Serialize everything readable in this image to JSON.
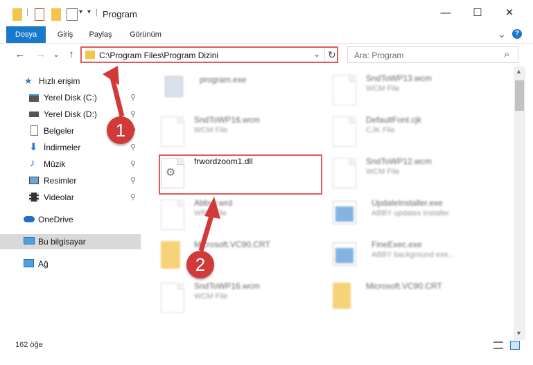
{
  "window": {
    "title": "Program",
    "minimize": "—",
    "maximize": "☐",
    "close": "✕"
  },
  "ribbon": {
    "tabs": [
      "Dosya",
      "Giriş",
      "Paylaş",
      "Görünüm"
    ],
    "collapse": "⌄",
    "help": "?"
  },
  "nav": {
    "back": "←",
    "forward": "→",
    "recent": "⌄",
    "up": "↑",
    "address": "C:\\Program Files\\Program Dizini",
    "address_dropdown": "⌄",
    "refresh": "↻",
    "search_placeholder": "Ara: Program",
    "search_icon": "⌕"
  },
  "sidebar": {
    "quick_access": "Hızlı erişim",
    "items": [
      {
        "label": "Yerel Disk (C:)",
        "icon": "drive-icon"
      },
      {
        "label": "Yerel Disk (D:)",
        "icon": "drive-icon"
      },
      {
        "label": "Belgeler",
        "icon": "documents-icon"
      },
      {
        "label": "İndirmeler",
        "icon": "download-icon"
      },
      {
        "label": "Müzik",
        "icon": "music-icon"
      },
      {
        "label": "Resimler",
        "icon": "pictures-icon"
      },
      {
        "label": "Videolar",
        "icon": "video-icon"
      }
    ],
    "onedrive": "OneDrive",
    "this_pc": "Bu bilgisayar",
    "network": "Ağ",
    "pin_glyph": "📌"
  },
  "files": [
    {
      "name": "program.exe",
      "type": ""
    },
    {
      "name": "SndToWP13.wcm",
      "type": "WCM File"
    },
    {
      "name": "SndToWP16.wcm",
      "type": "WCM File"
    },
    {
      "name": "DefaultFont.cjk",
      "type": "CJK File"
    },
    {
      "name": "frwordzoom1.dll",
      "type": ""
    },
    {
      "name": "SndToWP12.wcm",
      "type": "WCM File"
    },
    {
      "name": "Abbyy.wrd",
      "type": "WRD File"
    },
    {
      "name": "UpdateInstaller.exe",
      "type": "ABBY updates installer"
    },
    {
      "name": "Microsoft.VC90.CRT",
      "type": ""
    },
    {
      "name": "FineExec.exe",
      "type": "ABBY background exe..."
    },
    {
      "name": "SndToWP16.wcm",
      "type": "WCM File"
    },
    {
      "name": "Microsoft.VC90.CRT",
      "type": ""
    }
  ],
  "status": {
    "count": "162 öğe"
  },
  "annotations": {
    "one": "1",
    "two": "2"
  },
  "colors": {
    "accent": "#1979ca",
    "highlight": "#e05a5a",
    "badge": "#d23a3a"
  }
}
